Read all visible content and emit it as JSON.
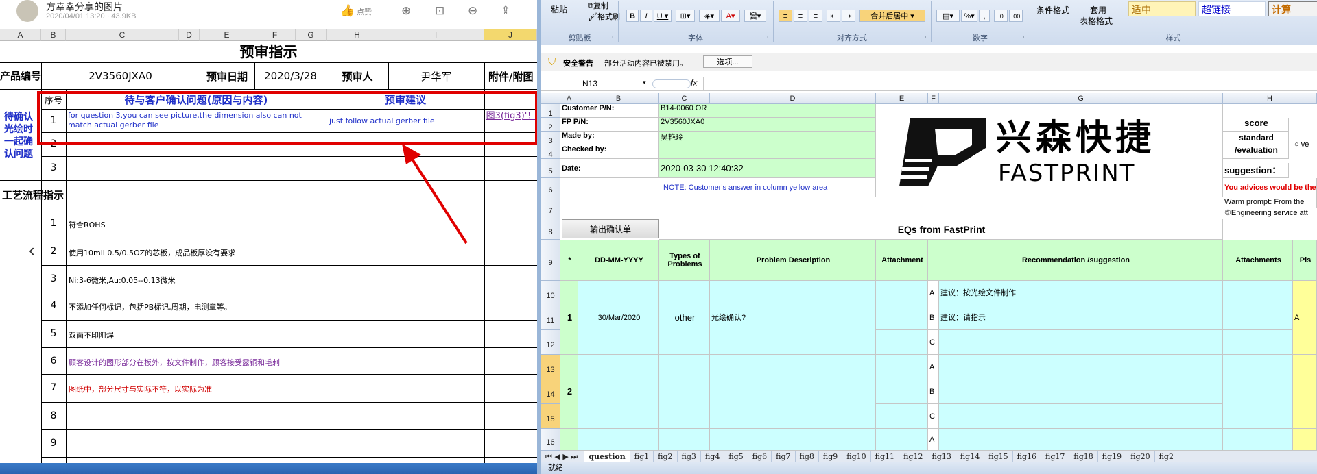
{
  "left": {
    "post_title": "方幸幸分享的图片",
    "post_meta": "2020/04/01 13:20 · 43.9KB",
    "like_label": "点赞",
    "columns": [
      "A",
      "B",
      "C",
      "D",
      "E",
      "F",
      "G",
      "H",
      "I",
      "J"
    ],
    "sheet_title": "预审指示",
    "header": {
      "product_no_label": "产品编号",
      "product_no": "2V3560JXA0",
      "pre_review_date_label": "预审日期",
      "pre_review_date": "2020/3/28",
      "reviewer_label": "预审人",
      "reviewer": "尹华军",
      "attachment_label": "附件/附图"
    },
    "confirm_section": {
      "side_label": "待确认光绘时一起确认问题",
      "seq_label": "序号",
      "issue_label": "待与客户确认问题(原因与内容)",
      "suggest_label": "预审建议",
      "rows": [
        {
          "no": "1",
          "issue": "for question 3.you can see picture,the dimension also can not match actual gerber file",
          "suggest": "just follow actual gerber file",
          "attach": "图3(fig3)'！"
        },
        {
          "no": "2",
          "issue": "",
          "suggest": "",
          "attach": ""
        },
        {
          "no": "3",
          "issue": "",
          "suggest": "",
          "attach": ""
        }
      ]
    },
    "process_section": {
      "label": "工艺流程指示",
      "rows": [
        {
          "no": "1",
          "text": "符合ROHS",
          "color": "#000000"
        },
        {
          "no": "2",
          "text": "使用10mil 0.5/0.5OZ的芯板，成品板厚没有要求",
          "color": "#000000"
        },
        {
          "no": "3",
          "text": "Ni:3-6微米,Au:0.05--0.13微米",
          "color": "#000000"
        },
        {
          "no": "4",
          "text": "不添加任何标记，包括PB标记,周期，电测章等。",
          "color": "#000000"
        },
        {
          "no": "5",
          "text": "双面不印阻焊",
          "color": "#000000"
        },
        {
          "no": "6",
          "text": "顾客设计的图形部分在板外，按文件制作，顾客接受露铜和毛刺",
          "color": "#7a2a9a"
        },
        {
          "no": "7",
          "text": "图纸中，部分尺寸与实际不符，以实际为准",
          "color": "#d00000"
        },
        {
          "no": "8",
          "text": "",
          "color": "#000000"
        },
        {
          "no": "9",
          "text": "",
          "color": "#000000"
        }
      ]
    }
  },
  "ribbon": {
    "paste": "粘贴",
    "copy": "复制",
    "format_painter": "格式刷",
    "groups": [
      "剪贴板",
      "字体",
      "对齐方式",
      "数字",
      "样式"
    ],
    "merge_center": "合并后居中",
    "cond_format": "条件格式",
    "apply": "套用",
    "table_format": "表格格式",
    "style_moderate": "适中",
    "style_hyperlink": "超链接",
    "style_calc": "计算"
  },
  "security": {
    "label": "安全警告",
    "message": "部分活动内容已被禁用。",
    "options": "选项..."
  },
  "formula": {
    "name_box": "N13",
    "fx": "fx"
  },
  "excel": {
    "columns": [
      "A",
      "B",
      "C",
      "D",
      "E",
      "F",
      "G",
      "H"
    ],
    "info": {
      "customer_pn_label": "Customer P/N:",
      "customer_pn": "B14-0060 OR",
      "fp_pn_label": "FP P/N:",
      "fp_pn": "2V3560JXA0",
      "made_by_label": "Made by:",
      "made_by": "吴艳玲",
      "checked_by_label": "Checked by:",
      "date_label": "Date:",
      "date": "2020-03-30 12:40:32",
      "note": "NOTE: Customer's  answer in column yellow area"
    },
    "logo_cn": "兴森快捷",
    "logo_en": "FASTPRINT",
    "score_label": "score",
    "standard_label": "standard /evaluation",
    "radio_label": "ve",
    "suggestion_label": "suggestion：",
    "advice": "You advices would be the",
    "warm_prompt": "Warm prompt:  From the",
    "engineering": "⑤Engineering service att",
    "export_btn": "输出确认单",
    "eq_title": "EQs from FastPrint",
    "table_headers": {
      "star": "*",
      "date": "DD-MM-YYYY",
      "types": "Types of Problems",
      "problem": "Problem Description",
      "attachment": "Attachment",
      "recommend": "Recommendation /suggestion",
      "attachments": "Attachments",
      "pls": "Pls"
    },
    "eq1": {
      "no": "1",
      "date": "30/Mar/2020",
      "type": "other",
      "desc": "光绘确认?",
      "sugg_a": "建议：按光绘文件制作",
      "sugg_b": "建议：请指示",
      "answer": "A"
    },
    "eq2": {
      "no": "2"
    },
    "abc": [
      "A",
      "B",
      "C"
    ],
    "row_numbers": [
      "1",
      "2",
      "3",
      "4",
      "5",
      "6",
      "7",
      "8",
      "9",
      "10",
      "11",
      "12",
      "13",
      "14",
      "15",
      "16"
    ]
  },
  "sheet_tabs": [
    "question",
    "fig1",
    "fig2",
    "fig3",
    "fig4",
    "fig5",
    "fig6",
    "fig7",
    "fig8",
    "fig9",
    "fig10",
    "fig11",
    "fig12",
    "fig13",
    "fig14",
    "fig15",
    "fig16",
    "fig17",
    "fig18",
    "fig19",
    "fig20",
    "fig2"
  ],
  "status": "就绪"
}
